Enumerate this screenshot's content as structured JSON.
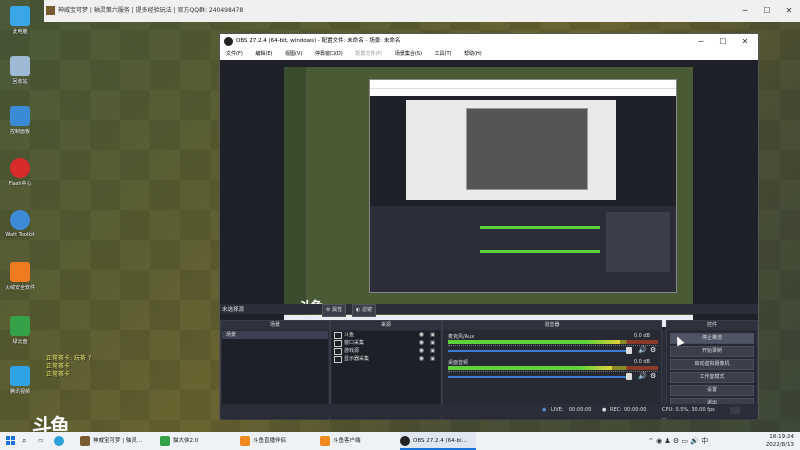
{
  "game_window": {
    "title": "神威宝可梦 | 轴灵策六服务 | 提多经验玩法 | 官方QQ群: 240498478",
    "chat_lines": [
      "正常茶卡: 玩茶 ?",
      "正常茶卡",
      "正常茶卡"
    ]
  },
  "desktop_icons": [
    {
      "label": "此电脑",
      "icon": "computer-icon",
      "color": "#38a6e8"
    },
    {
      "label": "回收站",
      "icon": "recycle-bin-icon",
      "color": "#9fb9d5"
    },
    {
      "label": "控制面板",
      "icon": "control-panel-icon",
      "color": "#3a8bd6"
    },
    {
      "label": "Flash中心",
      "icon": "flash-icon",
      "color": "#d92b2b"
    },
    {
      "label": "Watt Toolkit",
      "icon": "steam-icon",
      "color": "#3c8ad8"
    },
    {
      "label": "火绒安全软件",
      "icon": "huorong-icon",
      "color": "#f07a20"
    },
    {
      "label": "绿云盘",
      "icon": "leaf-icon",
      "color": "#35a24a"
    },
    {
      "label": "腾讯视频",
      "icon": "tencent-video-icon",
      "color": "#2fa3e8"
    }
  ],
  "watermark": "斗鱼",
  "obs": {
    "title": "OBS 27.2.4 (64-bit, windows) - 配置文件: 未命名 - 场景: 未命名",
    "menu": [
      "文件(F)",
      "编辑(E)",
      "视图(V)",
      "停靠窗口(D)",
      "配置文件(P)",
      "场景集合(S)",
      "工具(T)",
      "帮助(H)"
    ],
    "mode_label": "未选择源",
    "props_button": "属性",
    "filters_button": "滤镜",
    "docks": {
      "scenes": {
        "title": "场景",
        "items": [
          "场景"
        ]
      },
      "sources": {
        "title": "来源",
        "items": [
          {
            "name": "斗鱼",
            "icon": "image-source-icon"
          },
          {
            "name": "窗口采集",
            "icon": "window-capture-icon"
          },
          {
            "name": "游戏源",
            "icon": "game-capture-icon"
          },
          {
            "name": "显示器采集",
            "icon": "display-capture-icon"
          }
        ]
      },
      "mixer": {
        "title": "混音器",
        "channels": [
          {
            "name": "麦克风/Aux",
            "db": "0.0 dB",
            "level": 0.82
          },
          {
            "name": "桌面音频",
            "db": "0.0 dB",
            "level": 0.78
          }
        ]
      },
      "controls": {
        "title": "控件",
        "buttons": [
          "停止推流",
          "开始录制",
          "启动虚拟摄像机",
          "工作室模式",
          "设置",
          "退出"
        ]
      }
    },
    "status": {
      "live_label": "LIVE:",
      "live_time": "00:00:00",
      "rec_label": "REC:",
      "rec_time": "00:00:00",
      "cpu": "CPU: 0.5%, 30.00 fps"
    }
  },
  "taskbar": {
    "items": [
      {
        "label": "神威宝可梦 | 轴灵...",
        "color": "#7a5a30",
        "active": false
      },
      {
        "label": "猫大侠2.0",
        "color": "#35a24a",
        "active": false
      },
      {
        "label": "斗鱼直播伴侣",
        "color": "#f08a20",
        "active": false
      },
      {
        "label": "斗鱼客户端",
        "color": "#f08a20",
        "active": false
      },
      {
        "label": "OBS 27.2.4 (64-bi...",
        "color": "#222",
        "active": true
      }
    ],
    "time": "18:19:24",
    "date": "2022/8/13"
  }
}
